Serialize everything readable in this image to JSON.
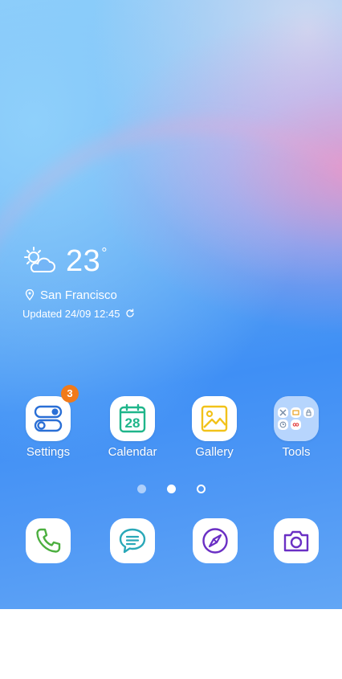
{
  "weather": {
    "temperature": "23",
    "unit": "°",
    "location": "San Francisco",
    "updated": "Updated 24/09 12:45",
    "icon": "partly-cloudy-icon"
  },
  "apps": [
    {
      "label": "Settings",
      "icon": "settings-icon",
      "badge": "3"
    },
    {
      "label": "Calendar",
      "icon": "calendar-icon",
      "date": "28"
    },
    {
      "label": "Gallery",
      "icon": "gallery-icon"
    },
    {
      "label": "Tools",
      "icon": "folder-icon"
    }
  ],
  "page_indicator": {
    "count": 3,
    "active": 1
  },
  "dock": [
    {
      "name": "phone",
      "icon": "phone-icon"
    },
    {
      "name": "messages",
      "icon": "messages-icon"
    },
    {
      "name": "internet",
      "icon": "compass-icon"
    },
    {
      "name": "camera",
      "icon": "camera-icon"
    }
  ],
  "colors": {
    "accent_green": "#4caf3f",
    "accent_teal": "#2aa8b8",
    "accent_purple": "#6a2fc4",
    "settings_blue": "#2a6fd6",
    "calendar_green": "#1fb58a",
    "gallery_yellow": "#f2c21a",
    "badge_orange": "#f07a1a"
  }
}
